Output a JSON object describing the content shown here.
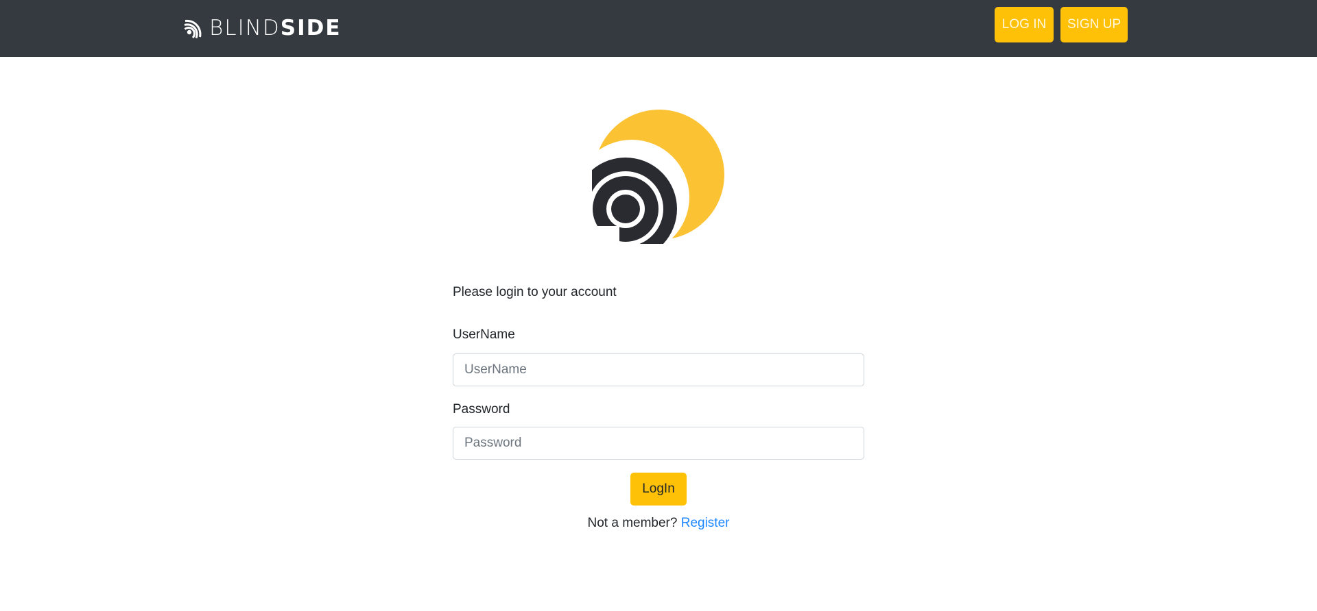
{
  "header": {
    "brand": {
      "name_part_light": "BLIND",
      "name_part_bold": "SIDE",
      "icon": "blindside-logo-icon"
    },
    "login_label": "LOG IN",
    "signup_label": "SIGN UP"
  },
  "main": {
    "logo_icon": "blindside-logo-icon",
    "prompt": "Please login to your account",
    "username": {
      "label": "UserName",
      "placeholder": "UserName",
      "value": ""
    },
    "password": {
      "label": "Password",
      "placeholder": "Password",
      "value": ""
    },
    "submit_label": "LogIn",
    "register_prefix": "Not a member?",
    "register_link": "Register"
  },
  "colors": {
    "navbar": "#343a40",
    "accent": "#ffc107",
    "logo_yellow": "#fbc334",
    "logo_dark": "#2a2b30",
    "link": "#1a86ff"
  }
}
